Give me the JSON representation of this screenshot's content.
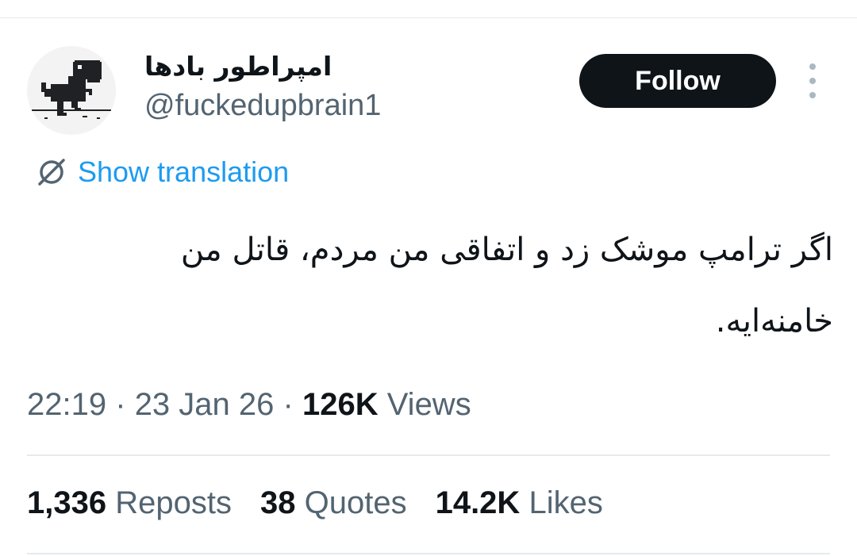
{
  "author": {
    "display_name": "امپراطور بادها",
    "handle": "@fuckedupbrain1",
    "avatar_icon": "pixel-dinosaur-icon"
  },
  "header": {
    "follow_label": "Follow",
    "more_icon": "more-vertical-icon"
  },
  "translation": {
    "icon": "globe-slash-icon",
    "label": "Show translation"
  },
  "tweet": {
    "text": "اگر ترامپ موشک زد و اتفاقی من مردم، قاتل من خامنه‌ایه."
  },
  "meta": {
    "time": "22:19",
    "separator": "·",
    "date": "23 Jan 26",
    "views_count": "126K",
    "views_label": "Views"
  },
  "stats": {
    "reposts_count": "1,336",
    "reposts_label": "Reposts",
    "quotes_count": "38",
    "quotes_label": "Quotes",
    "likes_count": "14.2K",
    "likes_label": "Likes"
  },
  "colors": {
    "accent": "#1d9bf0",
    "text_primary": "#0f1419",
    "text_secondary": "#536471",
    "follow_bg": "#0f1419",
    "divider": "#e6eaed"
  }
}
